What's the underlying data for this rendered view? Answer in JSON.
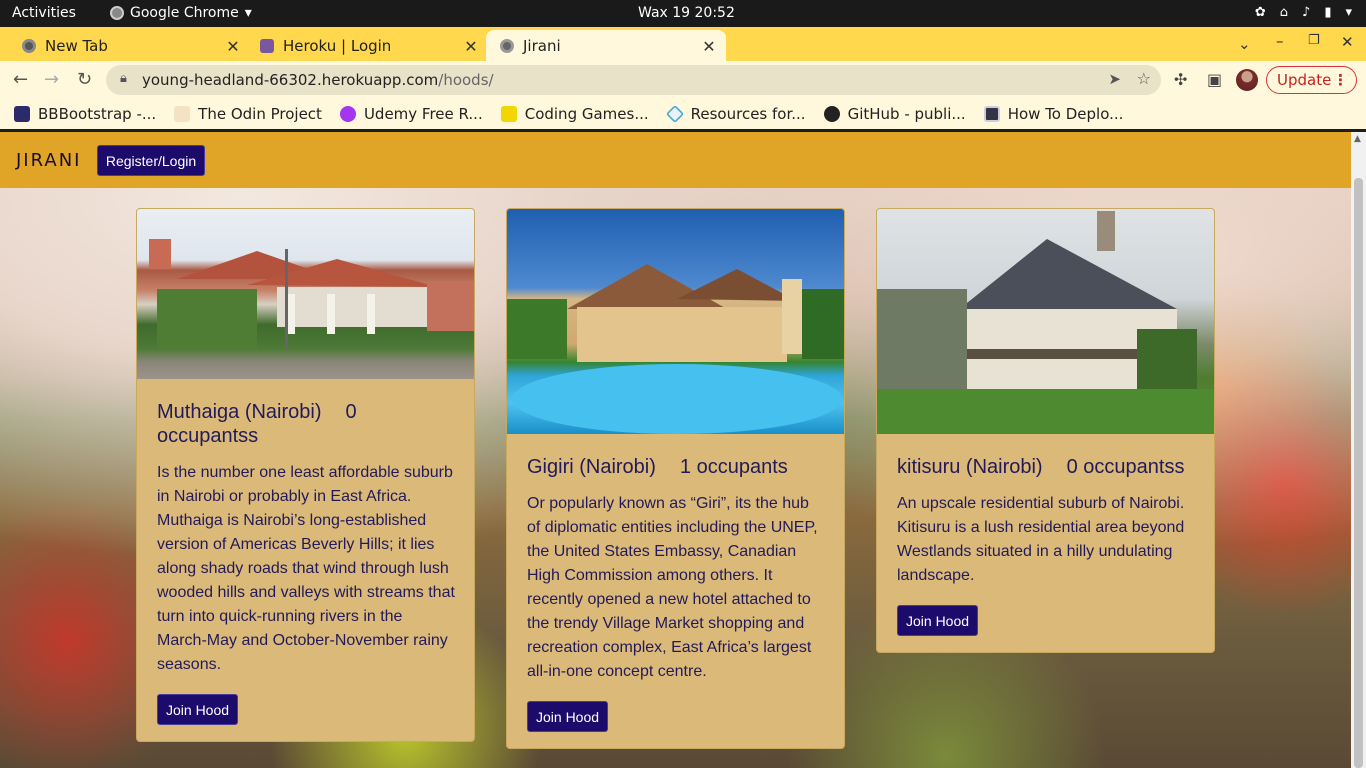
{
  "topbar": {
    "activities": "Activities",
    "app": "Google Chrome",
    "clock": "Wax 19  20:52"
  },
  "tabs": [
    {
      "label": "New Tab",
      "close": "✕"
    },
    {
      "label": "Heroku | Login",
      "close": "✕"
    },
    {
      "label": "Jirani",
      "close": "✕"
    }
  ],
  "toolbar": {
    "url_host": "young-headland-66302.herokuapp.com",
    "url_path": "/hoods/",
    "update": "Update"
  },
  "bookmarks": [
    {
      "label": "BBBootstrap -..."
    },
    {
      "label": "The Odin Project"
    },
    {
      "label": "Udemy Free R..."
    },
    {
      "label": "Coding Games..."
    },
    {
      "label": "Resources for..."
    },
    {
      "label": "GitHub - publi..."
    },
    {
      "label": "How To Deplo..."
    }
  ],
  "site": {
    "brand": "JIRANI",
    "register_login": "Register/Login",
    "hoods": [
      {
        "name": "Muthaiga (Nairobi)",
        "occupants": "0 occupantss",
        "description": "Is the number one least affordable suburb in Nairobi or probably in East Africa. Muthaiga is Nairobi’s long-established version of Americas Beverly Hills; it lies along shady roads that wind through lush wooded hills and valleys with streams that turn into quick-running rivers in the March-May and October-November rainy seasons.",
        "join": "Join Hood"
      },
      {
        "name": "Gigiri (Nairobi)",
        "occupants": "1 occupants",
        "description": "Or popularly known as “Giri”, its the hub of diplomatic entities including the UNEP, the United States Embassy, Canadian High Commission among others. It recently opened a new hotel attached to the trendy Village Market shopping and recreation complex, East Africa’s largest all-in-one concept centre.",
        "join": "Join Hood"
      },
      {
        "name": "kitisuru (Nairobi)",
        "occupants": "0 occupantss",
        "description": "An upscale residential suburb of Nairobi. Kitisuru is a lush residential area beyond Westlands situated in a hilly undulating landscape.",
        "join": "Join Hood"
      }
    ]
  }
}
